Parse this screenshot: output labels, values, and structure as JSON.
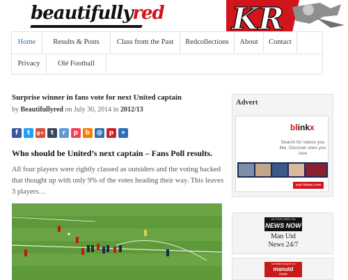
{
  "header": {
    "logo_main": "beautifully",
    "logo_accent": "red",
    "graphic_text": "KR"
  },
  "nav": {
    "items": [
      {
        "label": "Home",
        "active": true
      },
      {
        "label": "Results & Posts"
      },
      {
        "label": "Class from the Past"
      },
      {
        "label": "Redcollections"
      },
      {
        "label": "About"
      },
      {
        "label": "Contact"
      },
      {
        "label": "Privacy"
      },
      {
        "label": "Olé Football"
      }
    ]
  },
  "post": {
    "title": "Surprise winner in fans vote for next United captain",
    "meta_by": "by",
    "author": "Beautifullyred",
    "meta_on": "on July 30, 2014 in",
    "category": "2012/13",
    "heading": "Who should be United’s next captain – Fans Poll results.",
    "excerpt": "All four players were rightly classed as outsiders and the voting backed that thought up with only 9% of the votes heading their way. This leaves 3 players…"
  },
  "share_icons": [
    {
      "name": "facebook-icon",
      "glyph": "f",
      "color": "#3b5998"
    },
    {
      "name": "twitter-icon",
      "glyph": "t",
      "color": "#1da1f2"
    },
    {
      "name": "google-plus-icon",
      "glyph": "g+",
      "color": "#dd4b39"
    },
    {
      "name": "tumblr-icon",
      "glyph": "t",
      "color": "#35465c"
    },
    {
      "name": "reddit-icon",
      "glyph": "r",
      "color": "#5f99cf"
    },
    {
      "name": "pocket-icon",
      "glyph": "p",
      "color": "#ee4056"
    },
    {
      "name": "blogger-icon",
      "glyph": "b",
      "color": "#f57d00"
    },
    {
      "name": "email-icon",
      "glyph": "@",
      "color": "#2a6fb8"
    },
    {
      "name": "pinterest-icon",
      "glyph": "p",
      "color": "#cb2027"
    },
    {
      "name": "share-more-icon",
      "glyph": "+",
      "color": "#2a6fb8"
    }
  ],
  "sidebar": {
    "advert_title": "Advert",
    "ad_brand_a": "bl",
    "ad_brand_b": "ink",
    "ad_brand_c": "x",
    "ad_tagline": "Search for videos you like. Discover ones you love",
    "ad_button": "visit blinkx.com",
    "nn_badge_small": "AS FEATURED ON",
    "nn_badge_big": "NEWS NOW",
    "nn_label_1": "Man Utd",
    "nn_label_2": "News 24/7",
    "ts_badge_small": "a trusted source on",
    "ts_badge_big": "manutd",
    "ts_badge_small_2": "news",
    "brand_color": "#d0151c"
  }
}
